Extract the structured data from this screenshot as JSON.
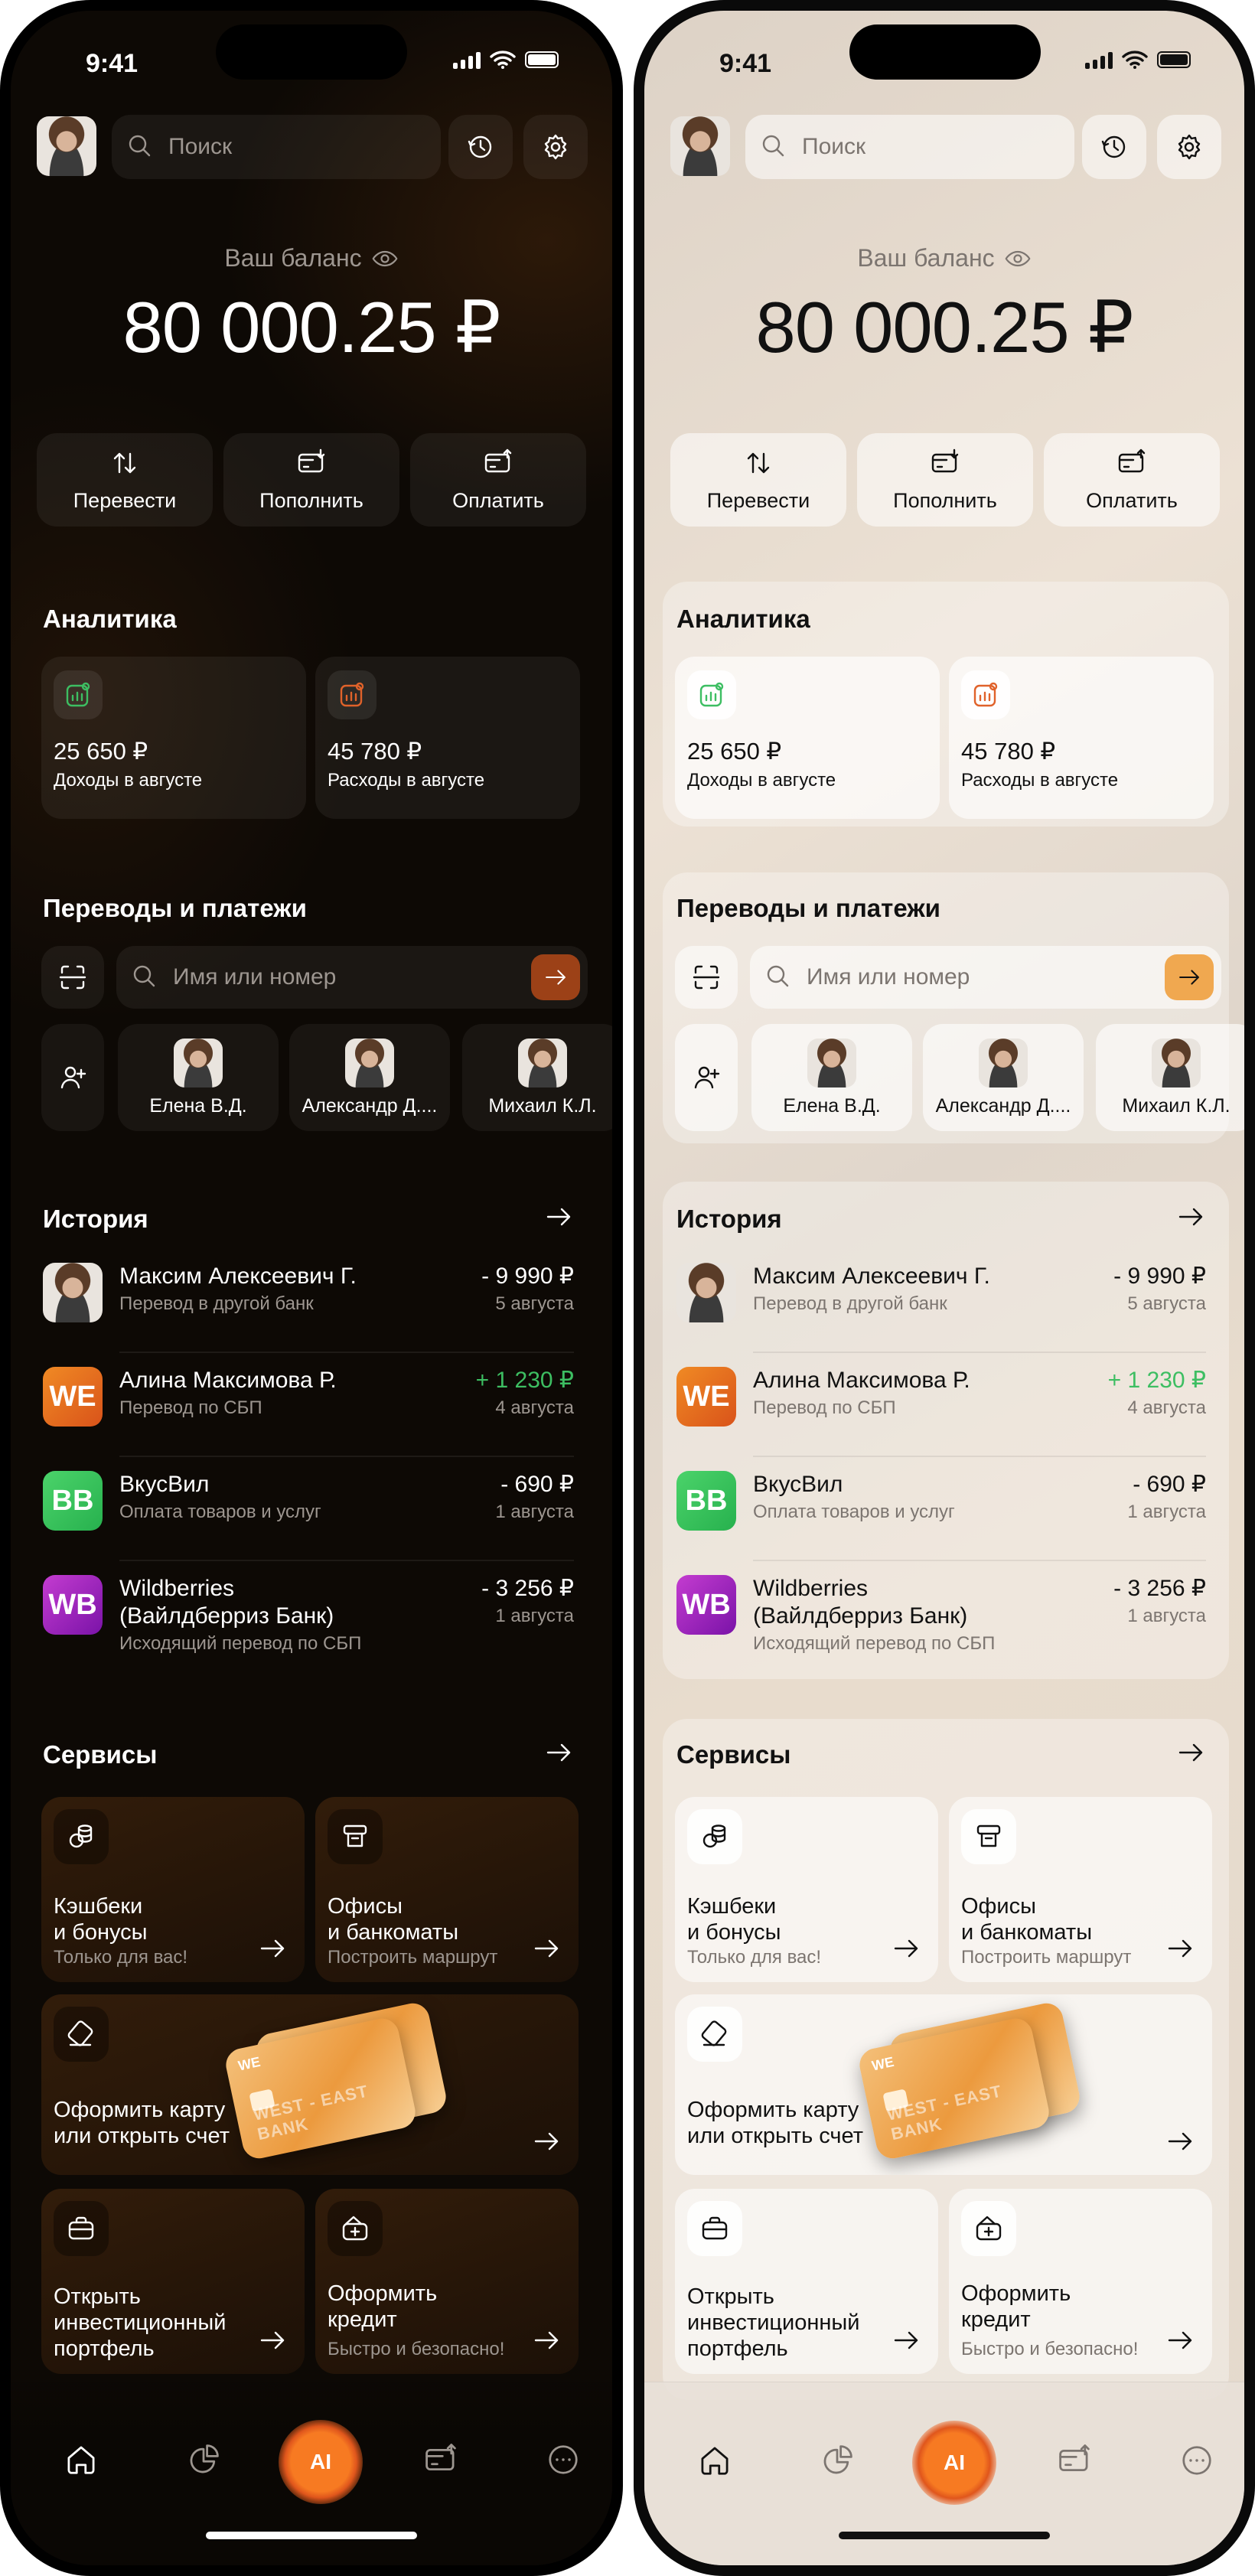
{
  "status": {
    "time": "9:41"
  },
  "header": {
    "search_placeholder": "Поиск"
  },
  "balance": {
    "label": "Ваш баланс",
    "amount": "80 000.25 ₽"
  },
  "actions": [
    {
      "label": "Перевести",
      "icon": "arrows-up-down-icon"
    },
    {
      "label": "Пополнить",
      "icon": "card-in-icon"
    },
    {
      "label": "Оплатить",
      "icon": "card-out-icon"
    }
  ],
  "analytics": {
    "title": "Аналитика",
    "income": {
      "amount": "25 650 ₽",
      "label": "Доходы в августе",
      "color": "#3dbe62"
    },
    "expense": {
      "amount": "45 780 ₽",
      "label": "Расходы в августе",
      "color": "#e0622a"
    }
  },
  "transfers": {
    "title": "Переводы и платежи",
    "search_placeholder": "Имя или номер",
    "contacts": [
      "Елена В.Д.",
      "Александр Д....",
      "Михаил К.Л."
    ]
  },
  "history": {
    "title": "История",
    "items": [
      {
        "name": "Максим Алексеевич Г.",
        "desc": "Перевод в другой банк",
        "amount": "- 9 990 ₽",
        "date": "5 августа",
        "positive": false,
        "logo": "avatar"
      },
      {
        "name": "Алина Максимова Р.",
        "desc": "Перевод по СБП",
        "amount": "+ 1 230 ₽",
        "date": "4 августа",
        "positive": true,
        "logo": "WE"
      },
      {
        "name": "ВкусВил",
        "desc": "Оплата товаров и услуг",
        "amount": "- 690 ₽",
        "date": "1 августа",
        "positive": false,
        "logo": "BB"
      },
      {
        "name": "Wildberries\n(Вайлдберриз Банк)",
        "desc": "Исходящий перевод по СБП",
        "amount": "- 3 256 ₽",
        "date": "1 августа",
        "positive": false,
        "logo": "WB"
      }
    ]
  },
  "services": {
    "title": "Сервисы",
    "items": [
      {
        "title": "Кэшбеки\nи бонусы",
        "sub": "Только для вас!"
      },
      {
        "title": "Офисы\nи банкоматы",
        "sub": "Построить маршрут"
      },
      {
        "title": "Оформить карту\nили открыть счет",
        "sub": "",
        "card_brand": "WE",
        "card_text": "WEST - EAST BANK"
      },
      {
        "title": "Открыть\nинвестиционный\nпортфель",
        "sub": ""
      },
      {
        "title": "Оформить\nкредит",
        "sub": "Быстро и безопасно!"
      }
    ]
  },
  "tabbar": {
    "ai_label": "AI"
  },
  "colors": {
    "accent_dark": "#9c4117",
    "accent_light": "#f0a850",
    "positive": "#3dbe62"
  }
}
